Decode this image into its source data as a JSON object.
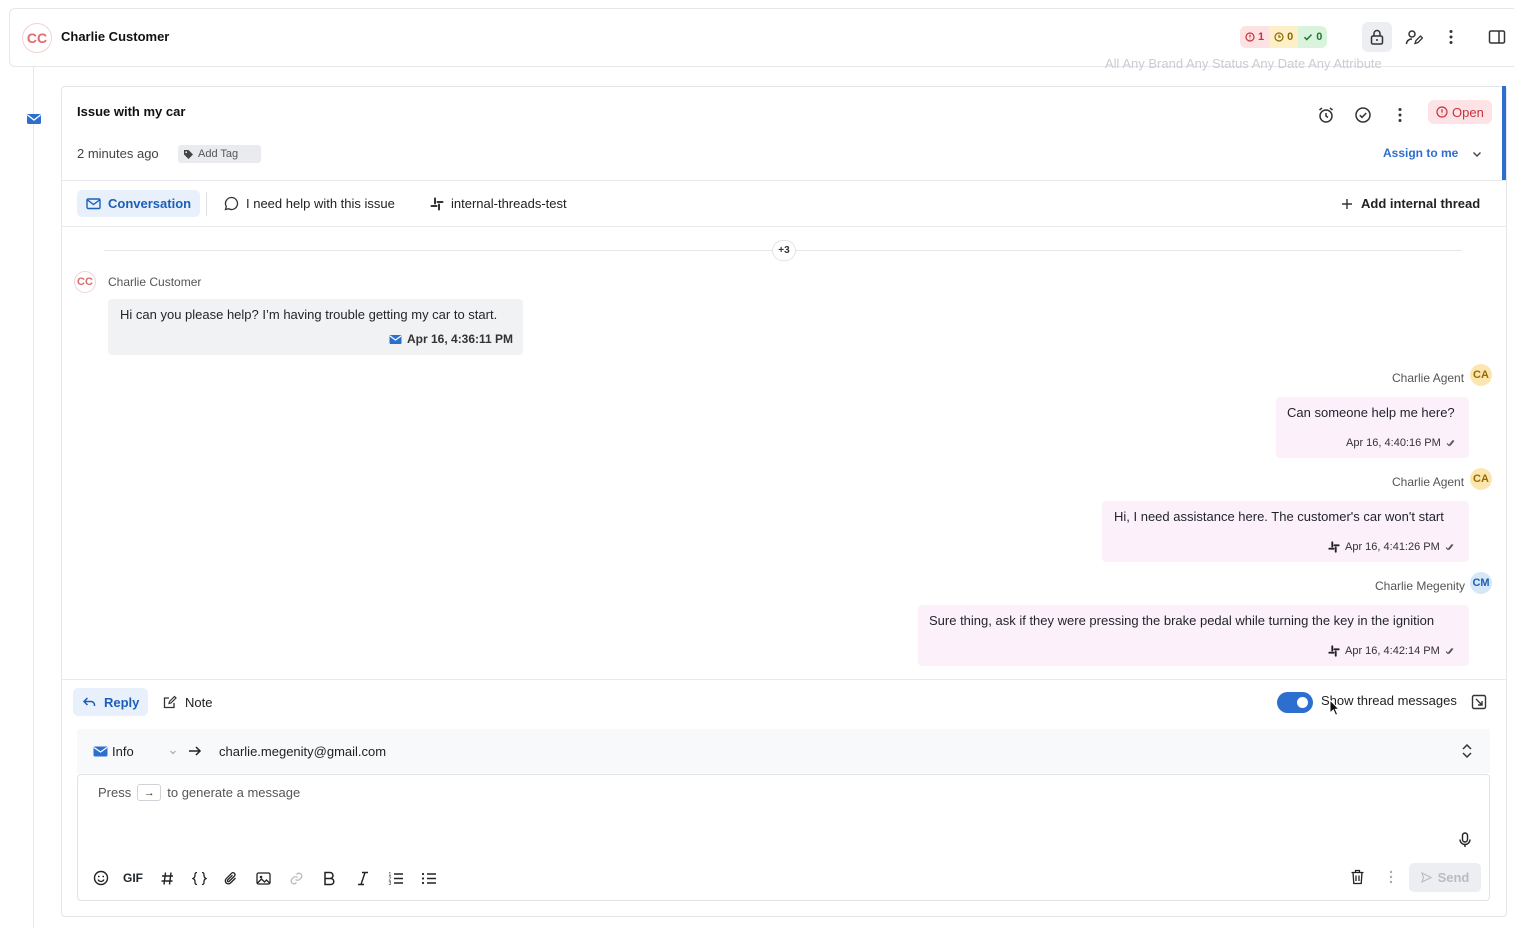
{
  "header": {
    "avatar_initials": "CC",
    "customer_name": "Charlie Customer",
    "counts": {
      "open": "1",
      "pending": "0",
      "resolved": "0"
    }
  },
  "filters_ghost": "All   Any Brand   Any Status   Any Date   Any Attribute",
  "ticket": {
    "title": "Issue with my car",
    "status": "Open",
    "created": "2 minutes ago",
    "add_tag": "Add Tag",
    "assign": "Assign to me"
  },
  "tabs": {
    "conversation": "Conversation",
    "help": "I need help with this issue",
    "slack": "internal-threads-test",
    "add_thread": "Add internal thread"
  },
  "conversation": {
    "hidden_count": "+3",
    "messages": [
      {
        "initials": "CC",
        "author": "Charlie Customer",
        "text": "Hi can you please help? I’m having trouble getting my car to start.",
        "time": "Apr 16, 4:36:11 PM",
        "channel_icon": "mail-icon"
      },
      {
        "initials": "CA",
        "author": "Charlie Agent",
        "text": "Can someone help me here?",
        "time": "Apr 16, 4:40:16 PM"
      },
      {
        "initials": "CA",
        "author": "Charlie Agent",
        "text": "Hi, I need assistance here. The customer's car won't start",
        "time": "Apr 16, 4:41:26 PM",
        "channel_icon": "slack-icon"
      },
      {
        "initials": "CM",
        "author": "Charlie Megenity",
        "text": "Sure thing, ask if they were pressing the brake pedal while turning the key in the ignition",
        "time": "Apr 16, 4:42:14 PM",
        "channel_icon": "slack-icon"
      }
    ]
  },
  "composer": {
    "reply": "Reply",
    "note": "Note",
    "show_thread": "Show thread messages",
    "show_thread_on": true,
    "channel": "Info",
    "recipient": "charlie.megenity@gmail.com",
    "placeholder_before": "Press",
    "placeholder_key": "→",
    "placeholder_after": "to generate a message",
    "gif": "GIF",
    "send": "Send"
  },
  "colors": {
    "accent": "#2d6fcf",
    "open": "#c8333d",
    "agent_bubble": "#fcf0fb"
  }
}
